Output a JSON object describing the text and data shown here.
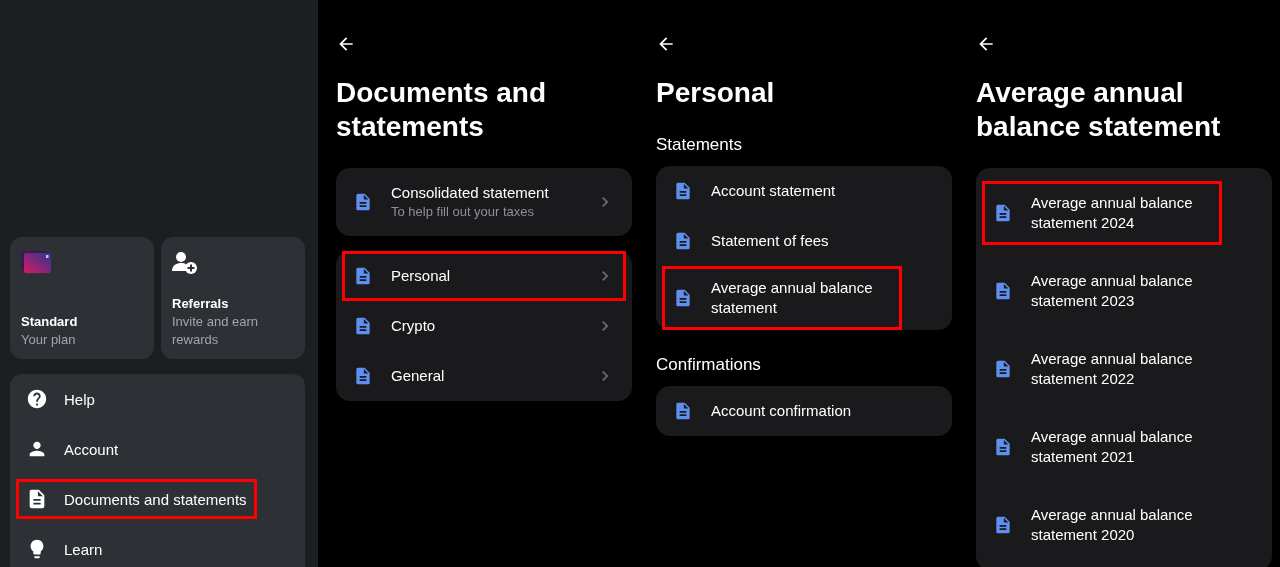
{
  "menu_panel": {
    "tiles": [
      {
        "kind": "plan",
        "title": "Standard",
        "subtitle": "Your plan"
      },
      {
        "kind": "referral",
        "title": "Referrals",
        "subtitle": "Invite and earn rewards"
      }
    ],
    "items": [
      {
        "kind": "help",
        "label": "Help",
        "highlighted": false
      },
      {
        "kind": "person",
        "label": "Account",
        "highlighted": false
      },
      {
        "kind": "document",
        "label": "Documents and statements",
        "highlighted": true
      },
      {
        "kind": "bulb",
        "label": "Learn",
        "highlighted": false
      }
    ]
  },
  "detail_panels": [
    {
      "title": "Documents and statements",
      "groups": [
        {
          "items": [
            {
              "label": "Consolidated statement",
              "sublabel": "To help fill out your taxes",
              "chevron": true,
              "highlighted": false
            }
          ]
        },
        {
          "items": [
            {
              "label": "Personal",
              "chevron": true,
              "highlighted": true
            },
            {
              "label": "Crypto",
              "chevron": true,
              "highlighted": false
            },
            {
              "label": "General",
              "chevron": true,
              "highlighted": false
            }
          ]
        }
      ]
    },
    {
      "title": "Personal",
      "groups": [
        {
          "heading": "Statements",
          "items": [
            {
              "label": "Account statement",
              "chevron": false,
              "highlighted": false
            },
            {
              "label": "Statement of fees",
              "chevron": false,
              "highlighted": false
            },
            {
              "label": "Average annual balance statement",
              "chevron": false,
              "highlighted": true
            }
          ]
        },
        {
          "heading": "Confirmations",
          "items": [
            {
              "label": "Account confirmation",
              "chevron": false,
              "highlighted": false
            }
          ]
        }
      ]
    },
    {
      "title": "Average annual balance statement",
      "groups": [
        {
          "items": [
            {
              "label": "Average annual balance statement 2024",
              "chevron": false,
              "highlighted": true
            },
            {
              "label": "Average annual balance statement 2023",
              "chevron": false,
              "highlighted": false
            },
            {
              "label": "Average annual balance statement 2022",
              "chevron": false,
              "highlighted": false
            },
            {
              "label": "Average annual balance statement 2021",
              "chevron": false,
              "highlighted": false
            },
            {
              "label": "Average annual balance statement 2020",
              "chevron": false,
              "highlighted": false
            }
          ]
        }
      ]
    }
  ]
}
